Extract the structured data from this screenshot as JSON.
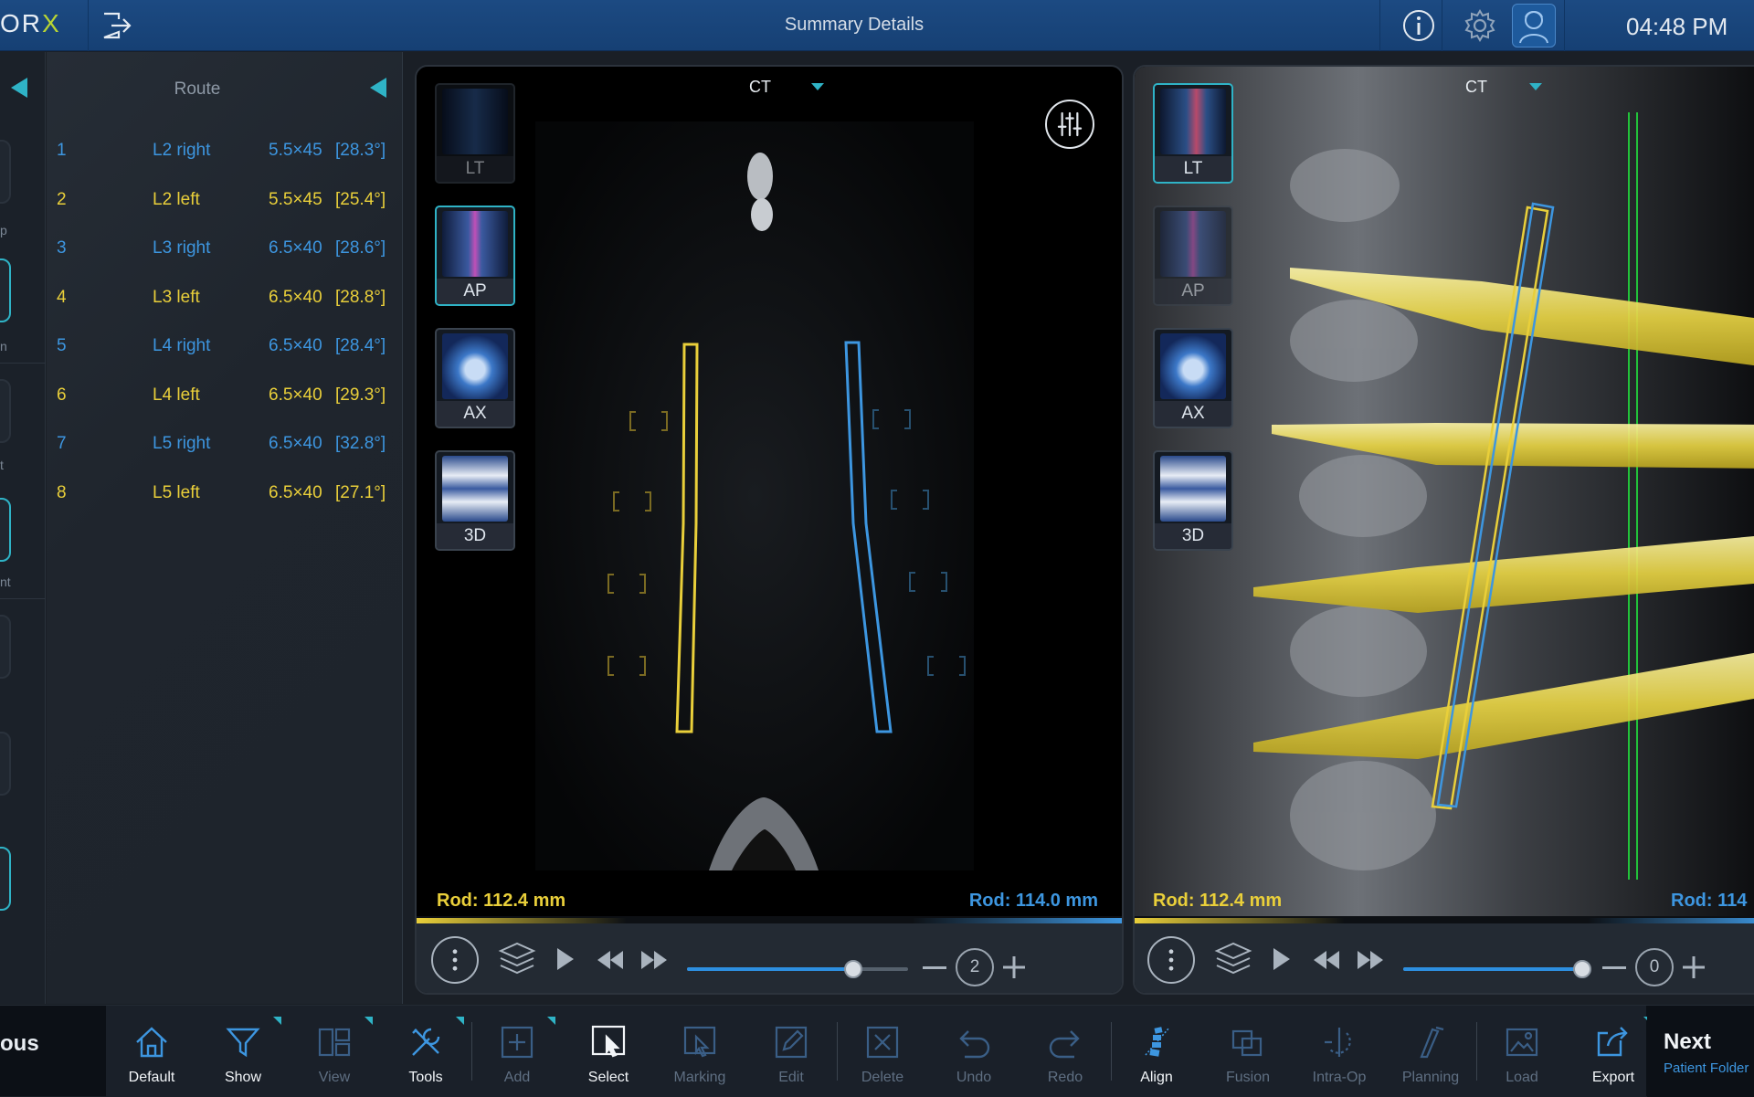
{
  "topbar": {
    "brand_prefix": "OR",
    "brand_x": "X",
    "title": "Summary Details",
    "clock": "04:48 PM"
  },
  "leftstrip": {
    "labels": [
      "p",
      "n",
      "t",
      "nt"
    ]
  },
  "route": {
    "title": "Route",
    "rows": [
      {
        "num": "1",
        "level": "L2 right",
        "size": "5.5×45",
        "angle": "[28.3°]",
        "side": "right"
      },
      {
        "num": "2",
        "level": "L2 left",
        "size": "5.5×45",
        "angle": "[25.4°]",
        "side": "left"
      },
      {
        "num": "3",
        "level": "L3 right",
        "size": "6.5×40",
        "angle": "[28.6°]",
        "side": "right"
      },
      {
        "num": "4",
        "level": "L3 left",
        "size": "6.5×40",
        "angle": "[28.8°]",
        "side": "left"
      },
      {
        "num": "5",
        "level": "L4 right",
        "size": "6.5×40",
        "angle": "[28.4°]",
        "side": "right"
      },
      {
        "num": "6",
        "level": "L4 left",
        "size": "6.5×40",
        "angle": "[29.3°]",
        "side": "left"
      },
      {
        "num": "7",
        "level": "L5 right",
        "size": "6.5×40",
        "angle": "[32.8°]",
        "side": "right"
      },
      {
        "num": "8",
        "level": "L5 left",
        "size": "6.5×40",
        "angle": "[27.1°]",
        "side": "left"
      }
    ]
  },
  "colors": {
    "right": "#3d96e0",
    "left": "#e9cf3a",
    "accent": "#2fb3c6"
  },
  "viewer1": {
    "modality": "CT",
    "thumbs": {
      "lt": "LT",
      "ap": "AP",
      "ax": "AX",
      "d3": "3D"
    },
    "rod_left": "Rod: 112.4 mm",
    "rod_right": "Rod: 114.0 mm",
    "slider_fraction": 0.75,
    "counter": "2"
  },
  "viewer2": {
    "modality": "CT",
    "thumbs": {
      "lt": "LT",
      "ap": "AP",
      "ax": "AX",
      "d3": "3D"
    },
    "rod_left": "Rod: 112.4 mm",
    "rod_right": "Rod: 114",
    "slider_fraction": 0.98,
    "counter": "0"
  },
  "toolbar": {
    "prev_label": "ous",
    "prev_sub": ":",
    "buttons": {
      "default": "Default",
      "show": "Show",
      "view": "View",
      "tools": "Tools",
      "add": "Add",
      "select": "Select",
      "marking": "Marking",
      "edit": "Edit",
      "delete": "Delete",
      "undo": "Undo",
      "redo": "Redo",
      "align": "Align",
      "fusion": "Fusion",
      "intraop": "Intra-Op",
      "planning": "Planning",
      "load": "Load",
      "export": "Export"
    },
    "next_label": "Next",
    "next_sub": "Patient Folder"
  }
}
